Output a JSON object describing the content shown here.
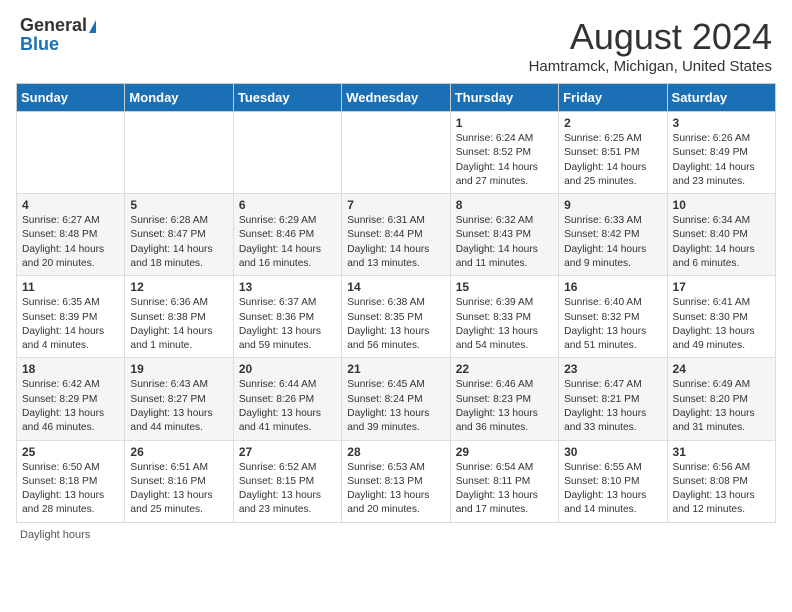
{
  "header": {
    "logo_general": "General",
    "logo_blue": "Blue",
    "month_year": "August 2024",
    "location": "Hamtramck, Michigan, United States"
  },
  "weekdays": [
    "Sunday",
    "Monday",
    "Tuesday",
    "Wednesday",
    "Thursday",
    "Friday",
    "Saturday"
  ],
  "weeks": [
    [
      {
        "day": "",
        "info": ""
      },
      {
        "day": "",
        "info": ""
      },
      {
        "day": "",
        "info": ""
      },
      {
        "day": "",
        "info": ""
      },
      {
        "day": "1",
        "info": "Sunrise: 6:24 AM\nSunset: 8:52 PM\nDaylight: 14 hours and 27 minutes."
      },
      {
        "day": "2",
        "info": "Sunrise: 6:25 AM\nSunset: 8:51 PM\nDaylight: 14 hours and 25 minutes."
      },
      {
        "day": "3",
        "info": "Sunrise: 6:26 AM\nSunset: 8:49 PM\nDaylight: 14 hours and 23 minutes."
      }
    ],
    [
      {
        "day": "4",
        "info": "Sunrise: 6:27 AM\nSunset: 8:48 PM\nDaylight: 14 hours and 20 minutes."
      },
      {
        "day": "5",
        "info": "Sunrise: 6:28 AM\nSunset: 8:47 PM\nDaylight: 14 hours and 18 minutes."
      },
      {
        "day": "6",
        "info": "Sunrise: 6:29 AM\nSunset: 8:46 PM\nDaylight: 14 hours and 16 minutes."
      },
      {
        "day": "7",
        "info": "Sunrise: 6:31 AM\nSunset: 8:44 PM\nDaylight: 14 hours and 13 minutes."
      },
      {
        "day": "8",
        "info": "Sunrise: 6:32 AM\nSunset: 8:43 PM\nDaylight: 14 hours and 11 minutes."
      },
      {
        "day": "9",
        "info": "Sunrise: 6:33 AM\nSunset: 8:42 PM\nDaylight: 14 hours and 9 minutes."
      },
      {
        "day": "10",
        "info": "Sunrise: 6:34 AM\nSunset: 8:40 PM\nDaylight: 14 hours and 6 minutes."
      }
    ],
    [
      {
        "day": "11",
        "info": "Sunrise: 6:35 AM\nSunset: 8:39 PM\nDaylight: 14 hours and 4 minutes."
      },
      {
        "day": "12",
        "info": "Sunrise: 6:36 AM\nSunset: 8:38 PM\nDaylight: 14 hours and 1 minute."
      },
      {
        "day": "13",
        "info": "Sunrise: 6:37 AM\nSunset: 8:36 PM\nDaylight: 13 hours and 59 minutes."
      },
      {
        "day": "14",
        "info": "Sunrise: 6:38 AM\nSunset: 8:35 PM\nDaylight: 13 hours and 56 minutes."
      },
      {
        "day": "15",
        "info": "Sunrise: 6:39 AM\nSunset: 8:33 PM\nDaylight: 13 hours and 54 minutes."
      },
      {
        "day": "16",
        "info": "Sunrise: 6:40 AM\nSunset: 8:32 PM\nDaylight: 13 hours and 51 minutes."
      },
      {
        "day": "17",
        "info": "Sunrise: 6:41 AM\nSunset: 8:30 PM\nDaylight: 13 hours and 49 minutes."
      }
    ],
    [
      {
        "day": "18",
        "info": "Sunrise: 6:42 AM\nSunset: 8:29 PM\nDaylight: 13 hours and 46 minutes."
      },
      {
        "day": "19",
        "info": "Sunrise: 6:43 AM\nSunset: 8:27 PM\nDaylight: 13 hours and 44 minutes."
      },
      {
        "day": "20",
        "info": "Sunrise: 6:44 AM\nSunset: 8:26 PM\nDaylight: 13 hours and 41 minutes."
      },
      {
        "day": "21",
        "info": "Sunrise: 6:45 AM\nSunset: 8:24 PM\nDaylight: 13 hours and 39 minutes."
      },
      {
        "day": "22",
        "info": "Sunrise: 6:46 AM\nSunset: 8:23 PM\nDaylight: 13 hours and 36 minutes."
      },
      {
        "day": "23",
        "info": "Sunrise: 6:47 AM\nSunset: 8:21 PM\nDaylight: 13 hours and 33 minutes."
      },
      {
        "day": "24",
        "info": "Sunrise: 6:49 AM\nSunset: 8:20 PM\nDaylight: 13 hours and 31 minutes."
      }
    ],
    [
      {
        "day": "25",
        "info": "Sunrise: 6:50 AM\nSunset: 8:18 PM\nDaylight: 13 hours and 28 minutes."
      },
      {
        "day": "26",
        "info": "Sunrise: 6:51 AM\nSunset: 8:16 PM\nDaylight: 13 hours and 25 minutes."
      },
      {
        "day": "27",
        "info": "Sunrise: 6:52 AM\nSunset: 8:15 PM\nDaylight: 13 hours and 23 minutes."
      },
      {
        "day": "28",
        "info": "Sunrise: 6:53 AM\nSunset: 8:13 PM\nDaylight: 13 hours and 20 minutes."
      },
      {
        "day": "29",
        "info": "Sunrise: 6:54 AM\nSunset: 8:11 PM\nDaylight: 13 hours and 17 minutes."
      },
      {
        "day": "30",
        "info": "Sunrise: 6:55 AM\nSunset: 8:10 PM\nDaylight: 13 hours and 14 minutes."
      },
      {
        "day": "31",
        "info": "Sunrise: 6:56 AM\nSunset: 8:08 PM\nDaylight: 13 hours and 12 minutes."
      }
    ]
  ],
  "footer": {
    "daylight_label": "Daylight hours"
  }
}
